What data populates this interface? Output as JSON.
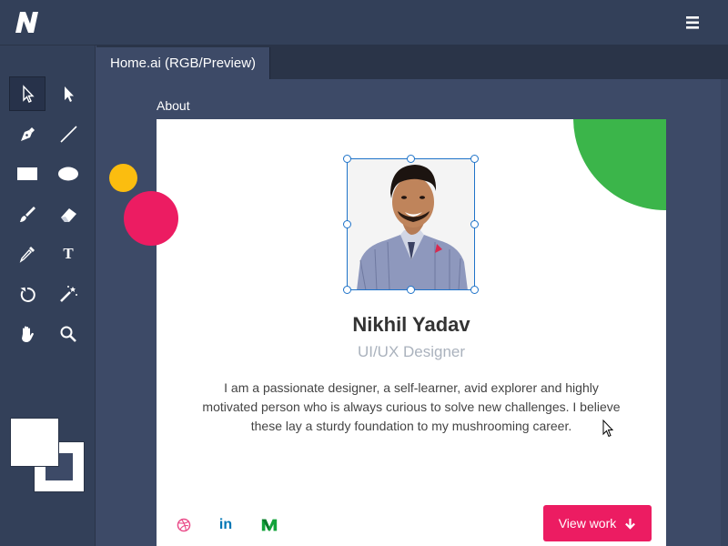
{
  "app": {
    "logo_letter": "N"
  },
  "tabs": [
    {
      "label": "Home.ai (RGB/Preview)"
    }
  ],
  "tools": [
    {
      "icon": "selection-arrow-icon"
    },
    {
      "icon": "direct-selection-icon"
    },
    {
      "icon": "pen-tool-icon"
    },
    {
      "icon": "line-tool-icon"
    },
    {
      "icon": "rectangle-tool-icon"
    },
    {
      "icon": "ellipse-tool-icon"
    },
    {
      "icon": "brush-tool-icon"
    },
    {
      "icon": "eraser-tool-icon"
    },
    {
      "icon": "eyedropper-tool-icon"
    },
    {
      "icon": "type-tool-icon",
      "label": "T"
    },
    {
      "icon": "rotate-tool-icon"
    },
    {
      "icon": "magic-wand-icon"
    },
    {
      "icon": "hand-tool-icon"
    },
    {
      "icon": "zoom-tool-icon"
    }
  ],
  "colors": {
    "fill": "#ffffff",
    "stroke": "#ffffff",
    "accent": "#ec1c62",
    "green": "#3bb54a",
    "yellow": "#fbbd0f",
    "selection": "#1e73c9"
  },
  "artboard": {
    "label": "About",
    "profile": {
      "name": "Nikhil Yadav",
      "role": "UI/UX Designer",
      "bio": "I am a passionate designer, a self-learner, avid explorer and highly motivated person who is always curious to solve new challenges. I believe these lay a sturdy foundation to my mushrooming career."
    },
    "social": [
      {
        "icon": "dribbble-icon"
      },
      {
        "icon": "linkedin-icon",
        "label": "in"
      },
      {
        "icon": "medium-icon"
      }
    ],
    "cta": {
      "label": "View work",
      "icon": "arrow-down-icon"
    }
  }
}
